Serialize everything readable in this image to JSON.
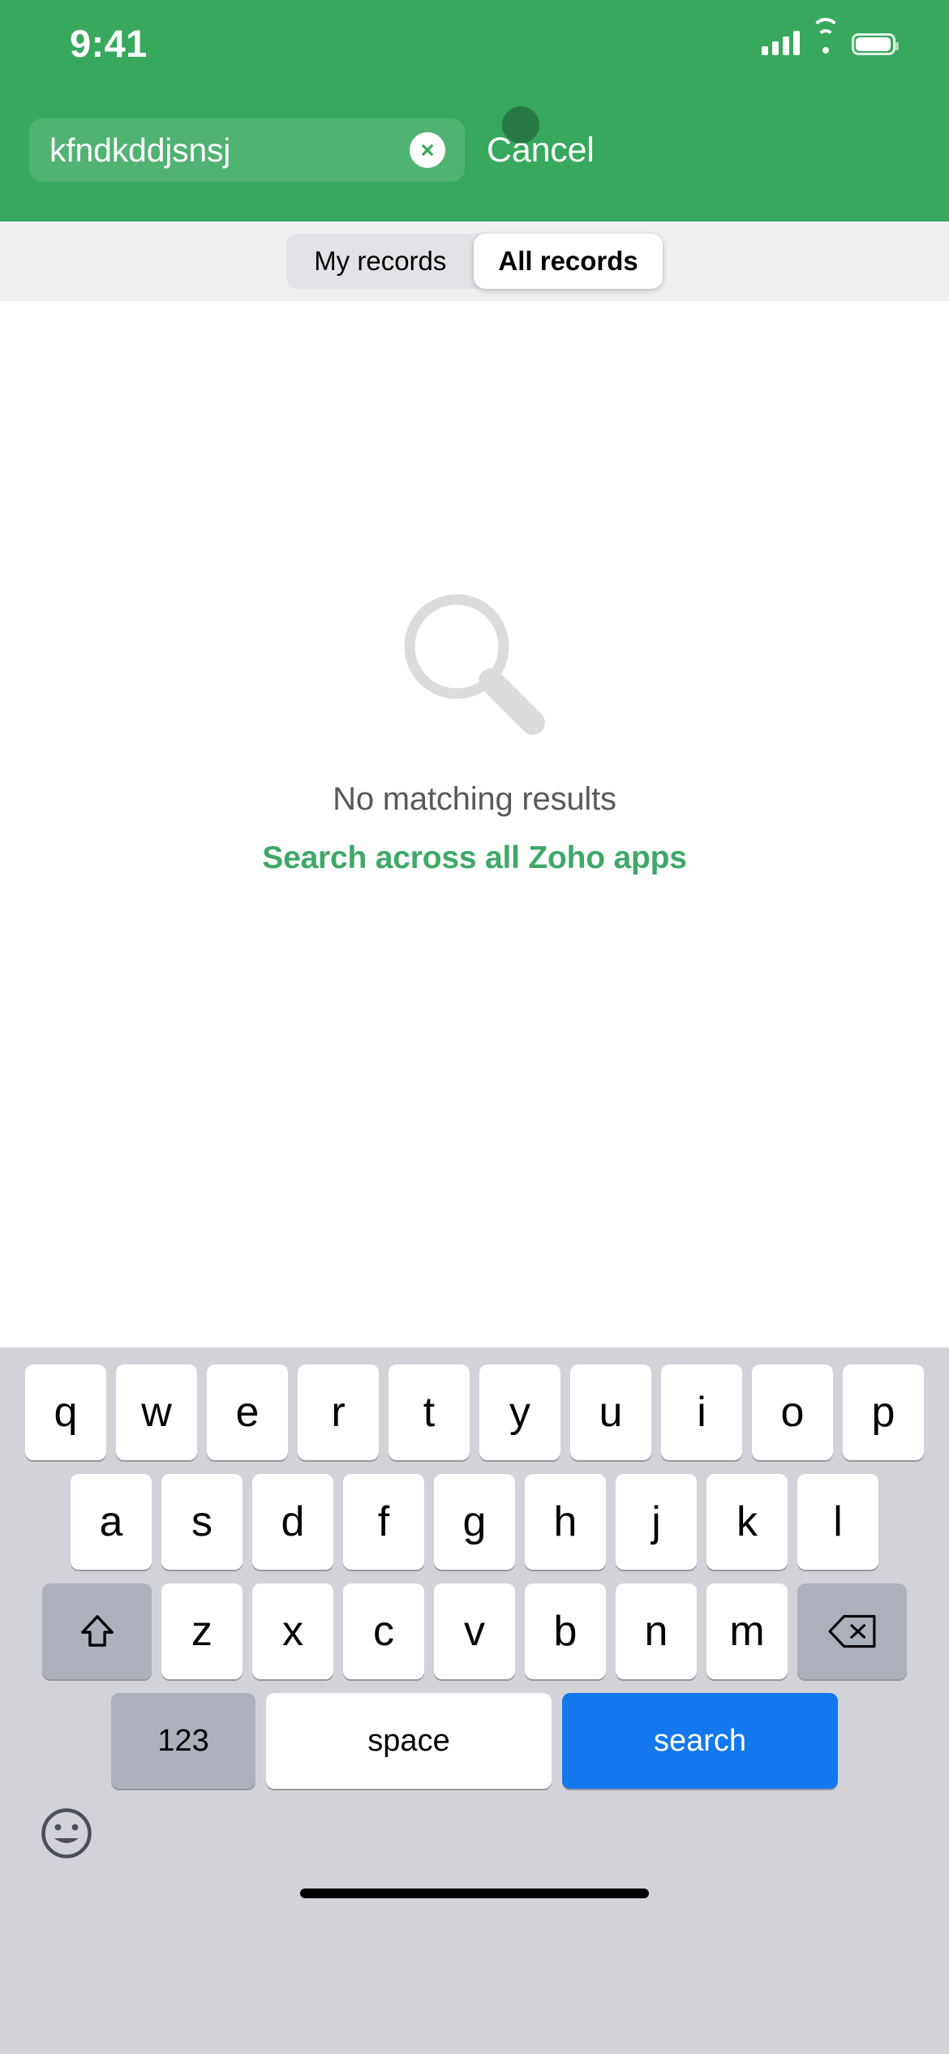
{
  "status_bar": {
    "time": "9:41",
    "signal_icon": "cellular-signal-icon",
    "wifi_icon": "wifi-icon",
    "battery_icon": "battery-icon"
  },
  "header": {
    "accent_color": "#37a85c",
    "search": {
      "value": "kfndkddjsnsj",
      "placeholder": "Search",
      "clear_icon": "clear-circle-icon"
    },
    "cancel_label": "Cancel"
  },
  "segmented_control": {
    "options": [
      {
        "label": "My records",
        "selected": false
      },
      {
        "label": "All records",
        "selected": true
      }
    ]
  },
  "empty_state": {
    "icon": "magnifier-icon",
    "icon_color": "#dcdcdc",
    "title": "No matching results",
    "link_label": "Search across all Zoho apps",
    "link_color": "#3fa868"
  },
  "keyboard": {
    "row1": [
      "q",
      "w",
      "e",
      "r",
      "t",
      "y",
      "u",
      "i",
      "o",
      "p"
    ],
    "row2": [
      "a",
      "s",
      "d",
      "f",
      "g",
      "h",
      "j",
      "k",
      "l"
    ],
    "row3": [
      "z",
      "x",
      "c",
      "v",
      "b",
      "n",
      "m"
    ],
    "shift_icon": "shift-arrow-icon",
    "backspace_icon": "backspace-icon",
    "numbers_label": "123",
    "space_label": "space",
    "search_label": "search",
    "search_key_color": "#1377ed",
    "emoji_icon": "emoji-smiley-icon"
  },
  "home_indicator": "home-indicator-bar"
}
